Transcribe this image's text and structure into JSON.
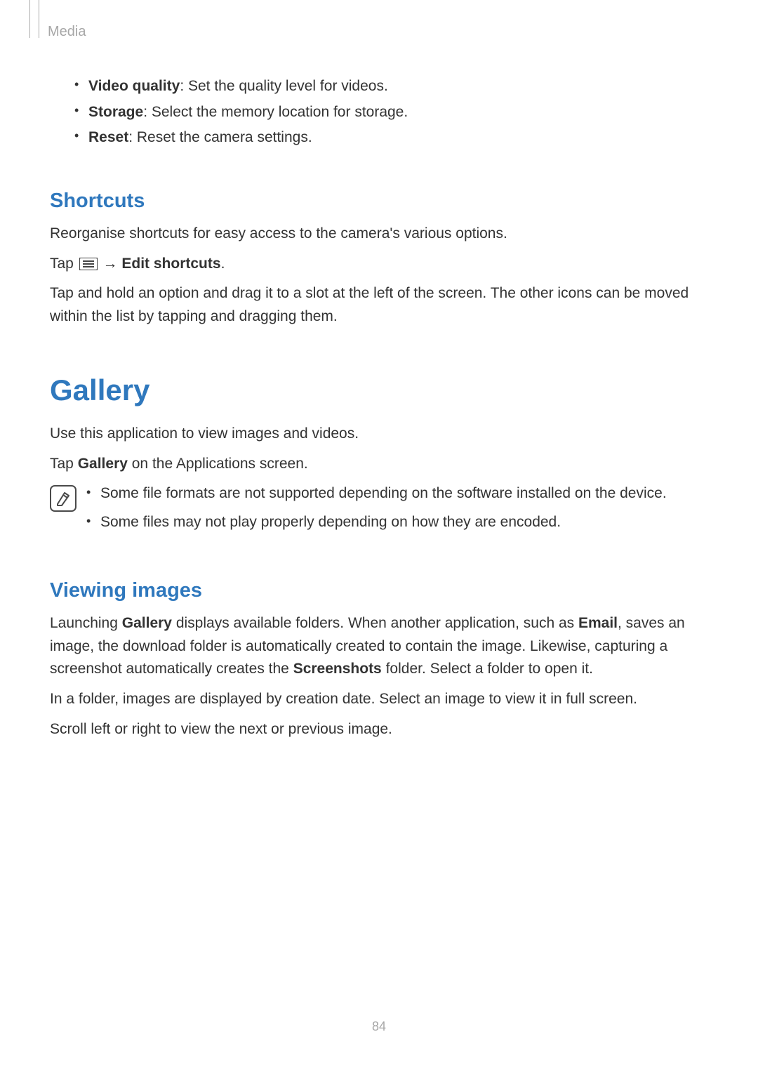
{
  "header": {
    "section": "Media"
  },
  "settings": [
    {
      "label": "Video quality",
      "desc": ": Set the quality level for videos."
    },
    {
      "label": "Storage",
      "desc": ": Select the memory location for storage."
    },
    {
      "label": "Reset",
      "desc": ": Reset the camera settings."
    }
  ],
  "shortcuts": {
    "heading": "Shortcuts",
    "intro": "Reorganise shortcuts for easy access to the camera's various options.",
    "tap_prefix": "Tap ",
    "tap_arrow": " → ",
    "tap_action": "Edit shortcuts",
    "tap_period": ".",
    "detail": "Tap and hold an option and drag it to a slot at the left of the screen. The other icons can be moved within the list by tapping and dragging them."
  },
  "gallery": {
    "heading": "Gallery",
    "intro": "Use this application to view images and videos.",
    "tap_prefix": "Tap ",
    "tap_bold": "Gallery",
    "tap_suffix": " on the Applications screen.",
    "notes": [
      "Some file formats are not supported depending on the software installed on the device.",
      "Some files may not play properly depending on how they are encoded."
    ]
  },
  "viewing": {
    "heading": "Viewing images",
    "p1_a": "Launching ",
    "p1_b": "Gallery",
    "p1_c": " displays available folders. When another application, such as ",
    "p1_d": "Email",
    "p1_e": ", saves an image, the download folder is automatically created to contain the image. Likewise, capturing a screenshot automatically creates the ",
    "p1_f": "Screenshots",
    "p1_g": " folder. Select a folder to open it.",
    "p2": "In a folder, images are displayed by creation date. Select an image to view it in full screen.",
    "p3": "Scroll left or right to view the next or previous image."
  },
  "page_number": "84"
}
